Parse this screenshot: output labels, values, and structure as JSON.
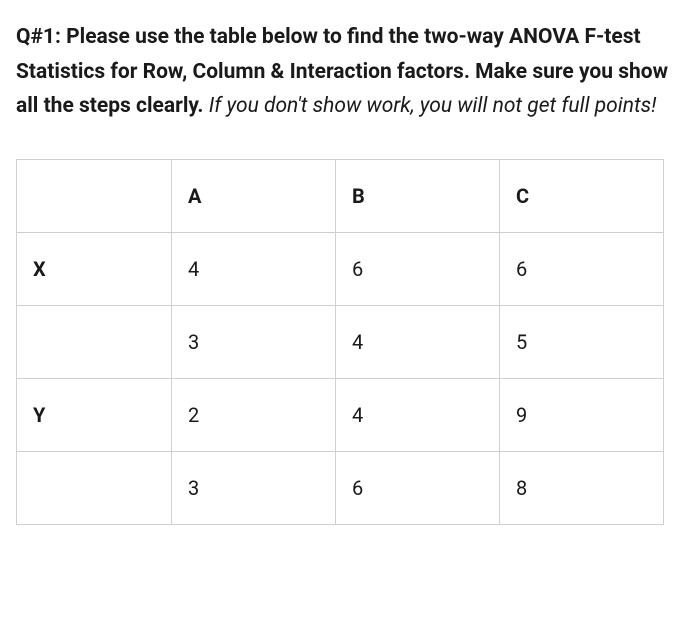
{
  "question": {
    "prefix": "Q#1: Please use the table below to find the two-way ANOVA F-test Statistics for Row, Column & Interaction factors. Make sure you show all the steps clearly.",
    "suffix": " If you don't show work, you will not get full points!"
  },
  "table": {
    "headers": [
      "",
      "A",
      "B",
      "C"
    ],
    "rows": [
      {
        "label": "X",
        "cells": [
          "4",
          "6",
          "6"
        ]
      },
      {
        "label": "",
        "cells": [
          "3",
          "4",
          "5"
        ]
      },
      {
        "label": "Y",
        "cells": [
          "2",
          "4",
          "9"
        ]
      },
      {
        "label": "",
        "cells": [
          "3",
          "6",
          "8"
        ]
      }
    ]
  }
}
